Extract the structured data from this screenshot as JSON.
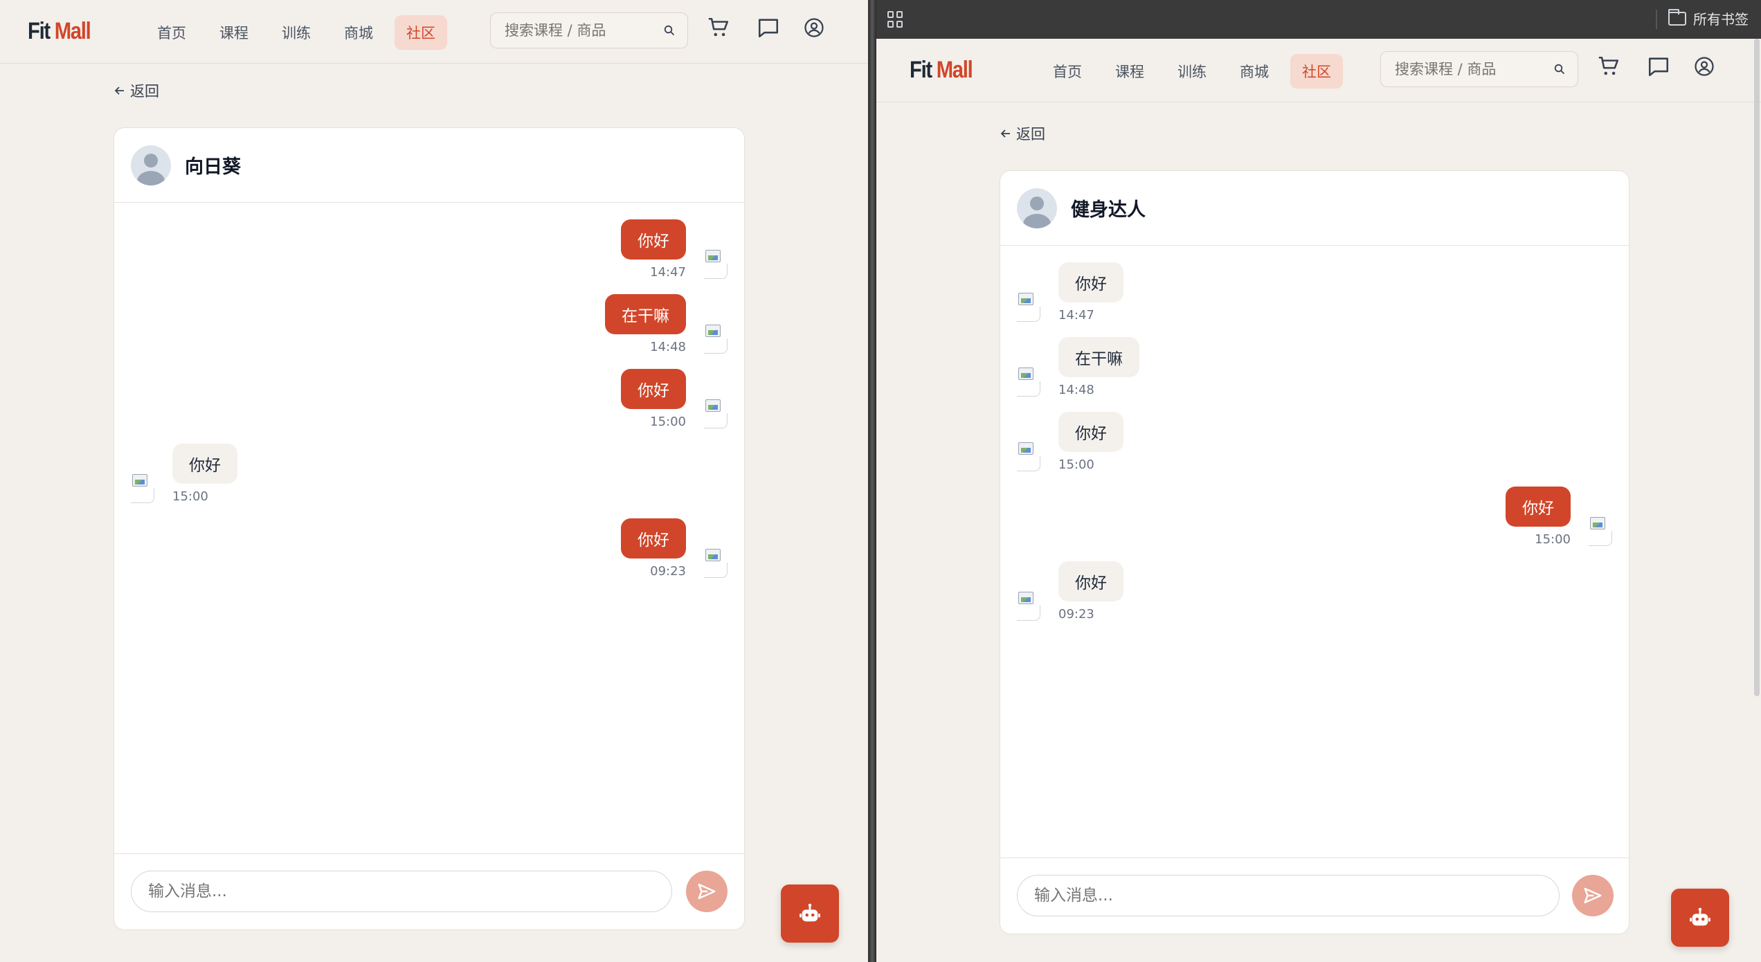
{
  "colors": {
    "accent": "#d1462a",
    "background": "#f3efea",
    "bubble_other": "#f4f1ed"
  },
  "left": {
    "logo": {
      "part1": "Fit",
      "part2": "Mall"
    },
    "nav": [
      {
        "label": "首页",
        "active": false
      },
      {
        "label": "课程",
        "active": false
      },
      {
        "label": "训练",
        "active": false
      },
      {
        "label": "商城",
        "active": false
      },
      {
        "label": "社区",
        "active": true
      }
    ],
    "search": {
      "placeholder": "搜索课程 / 商品"
    },
    "icons": [
      "cart-icon",
      "message-icon",
      "user-icon"
    ],
    "back_label": "返回",
    "contact_name": "向日葵",
    "messages": [
      {
        "text": "你好",
        "time": "14:47",
        "from": "me"
      },
      {
        "text": "在干嘛",
        "time": "14:48",
        "from": "me"
      },
      {
        "text": "你好",
        "time": "15:00",
        "from": "me"
      },
      {
        "text": "你好",
        "time": "15:00",
        "from": "them"
      },
      {
        "text": "你好",
        "time": "09:23",
        "from": "me"
      }
    ],
    "input": {
      "placeholder": "输入消息..."
    }
  },
  "right": {
    "browser": {
      "bookmarks_label": "所有书签"
    },
    "logo": {
      "part1": "Fit",
      "part2": "Mall"
    },
    "nav": [
      {
        "label": "首页",
        "active": false
      },
      {
        "label": "课程",
        "active": false
      },
      {
        "label": "训练",
        "active": false
      },
      {
        "label": "商城",
        "active": false
      },
      {
        "label": "社区",
        "active": true
      }
    ],
    "search": {
      "placeholder": "搜索课程 / 商品"
    },
    "icons": [
      "cart-icon",
      "message-icon",
      "user-icon"
    ],
    "back_label": "返回",
    "contact_name": "健身达人",
    "messages": [
      {
        "text": "你好",
        "time": "14:47",
        "from": "them"
      },
      {
        "text": "在干嘛",
        "time": "14:48",
        "from": "them"
      },
      {
        "text": "你好",
        "time": "15:00",
        "from": "them"
      },
      {
        "text": "你好",
        "time": "15:00",
        "from": "me"
      },
      {
        "text": "你好",
        "time": "09:23",
        "from": "them"
      }
    ],
    "input": {
      "placeholder": "输入消息..."
    }
  }
}
